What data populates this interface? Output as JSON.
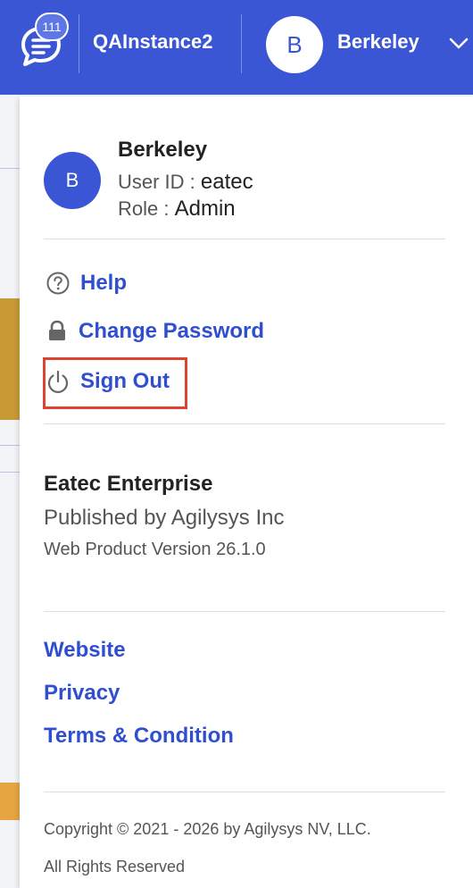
{
  "header": {
    "notification_count": "111",
    "instance_name": "QAInstance2",
    "avatar_initial": "B",
    "user_name": "Berkeley"
  },
  "profile": {
    "avatar_initial": "B",
    "name": "Berkeley",
    "user_id_label": "User ID :",
    "user_id_value": "eatec",
    "role_label": "Role :",
    "role_value": "Admin"
  },
  "menu": {
    "help": "Help",
    "change_password": "Change Password",
    "sign_out": "Sign Out"
  },
  "product": {
    "name": "Eatec Enterprise",
    "publisher": "Published by Agilysys Inc",
    "version": "Web Product Version 26.1.0"
  },
  "links": {
    "website": "Website",
    "privacy": "Privacy",
    "terms": "Terms & Condition"
  },
  "footer": {
    "copyright": "Copyright © 2021 - 2026 by Agilysys NV, LLC.",
    "rights": "All Rights Reserved"
  },
  "colors": {
    "header_bg": "#3a56d4",
    "link": "#2f4fd0",
    "highlight": "#d9452f"
  }
}
